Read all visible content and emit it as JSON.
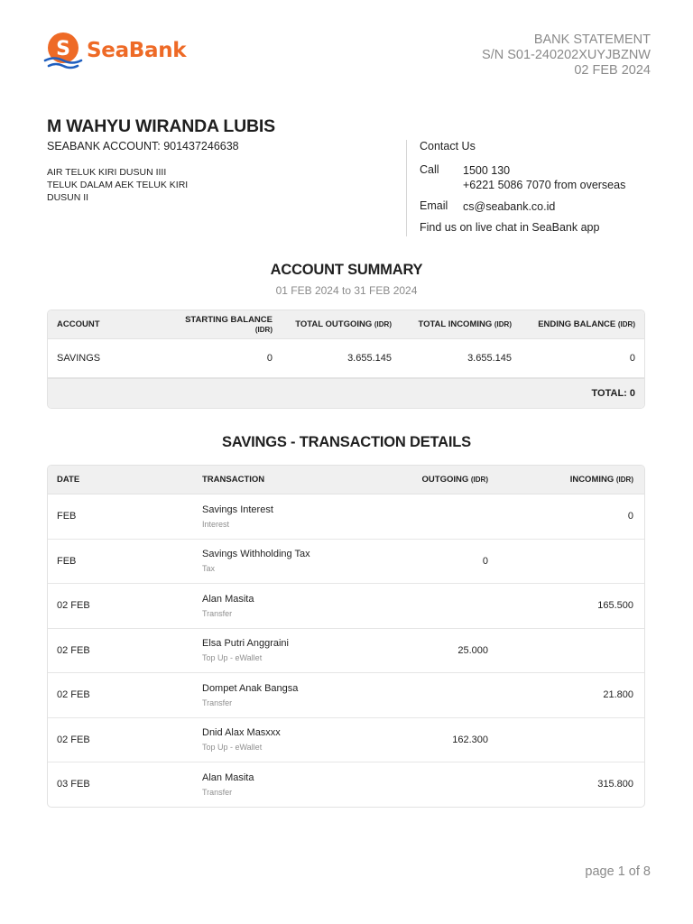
{
  "brand": {
    "name": "SeaBank",
    "logo_letter": "S",
    "accent": "#ee6a26",
    "wave_color": "#1f5fbf"
  },
  "statement": {
    "title": "BANK STATEMENT",
    "serial": "S/N S01-240202XUYJBZNW",
    "date": "02 FEB 2024"
  },
  "holder": {
    "name": "M WAHYU WIRANDA LUBIS",
    "account_line": "SEABANK ACCOUNT: 901437246638",
    "address": [
      "AIR TELUK KIRI DUSUN IIII",
      "TELUK DALAM AEK TELUK KIRI",
      "DUSUN II"
    ]
  },
  "contact": {
    "title": "Contact Us",
    "call_label": "Call",
    "call_values": [
      "1500 130",
      "+6221 5086 7070 from overseas"
    ],
    "email_label": "Email",
    "email_value": "cs@seabank.co.id",
    "chat_text": "Find us on live chat in SeaBank app"
  },
  "summary": {
    "title": "ACCOUNT SUMMARY",
    "period": "01 FEB 2024 to 31 FEB 2024",
    "headers": [
      {
        "label": "ACCOUNT",
        "unit": ""
      },
      {
        "label": "STARTING BALANCE",
        "unit": "(IDR)"
      },
      {
        "label": "TOTAL OUTGOING",
        "unit": "(IDR)"
      },
      {
        "label": "TOTAL INCOMING",
        "unit": "(IDR)"
      },
      {
        "label": "ENDING BALANCE",
        "unit": "(IDR)"
      }
    ],
    "rows": [
      {
        "account": "SAVINGS",
        "starting": "0",
        "outgoing": "3.655.145",
        "incoming": "3.655.145",
        "ending": "0"
      }
    ],
    "total": "TOTAL: 0"
  },
  "transactions": {
    "title": "SAVINGS - TRANSACTION DETAILS",
    "headers": [
      {
        "label": "DATE",
        "unit": ""
      },
      {
        "label": "TRANSACTION",
        "unit": ""
      },
      {
        "label": "OUTGOING",
        "unit": "(IDR)"
      },
      {
        "label": "INCOMING",
        "unit": "(IDR)"
      }
    ],
    "rows": [
      {
        "date": "FEB",
        "name": "Savings Interest",
        "type": "Interest",
        "outgoing": "",
        "incoming": "0"
      },
      {
        "date": "FEB",
        "name": "Savings Withholding Tax",
        "type": "Tax",
        "outgoing": "0",
        "incoming": ""
      },
      {
        "date": "02 FEB",
        "name": "Alan Masita",
        "type": "Transfer",
        "outgoing": "",
        "incoming": "165.500"
      },
      {
        "date": "02 FEB",
        "name": "Elsa Putri Anggraini",
        "type": "Top Up - eWallet",
        "outgoing": "25.000",
        "incoming": ""
      },
      {
        "date": "02 FEB",
        "name": "Dompet Anak Bangsa",
        "type": "Transfer",
        "outgoing": "",
        "incoming": "21.800"
      },
      {
        "date": "02 FEB",
        "name": "Dnid Alax Masxxx",
        "type": "Top Up - eWallet",
        "outgoing": "162.300",
        "incoming": ""
      },
      {
        "date": "03 FEB",
        "name": "Alan Masita",
        "type": "Transfer",
        "outgoing": "",
        "incoming": "315.800"
      }
    ]
  },
  "footer": {
    "page": "page 1 of 8"
  }
}
